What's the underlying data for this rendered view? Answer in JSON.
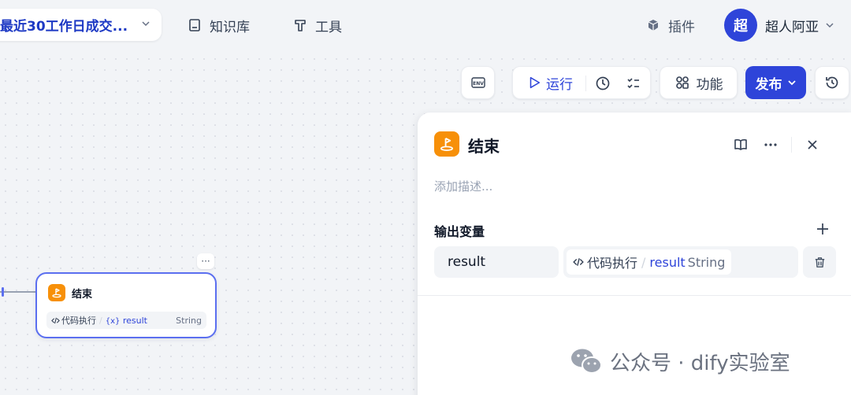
{
  "app": {
    "title": "最近30工作日成交..."
  },
  "nav": {
    "knowledge": "知识库",
    "tools": "工具",
    "plugins": "插件"
  },
  "user": {
    "avatar_text": "超",
    "name": "超人阿亚"
  },
  "toolbar": {
    "env": "ENV",
    "run": "运行",
    "features": "功能",
    "publish": "发布"
  },
  "node": {
    "title": "结束",
    "more": "···",
    "output": {
      "source": "代码执行",
      "variable": "result",
      "type": "String"
    }
  },
  "panel": {
    "title": "结束",
    "description_placeholder": "添加描述...",
    "section_title": "输出变量",
    "outputs": [
      {
        "name": "result",
        "source": "代码执行",
        "variable": "result",
        "type": "String"
      }
    ]
  },
  "watermark": {
    "text": "公众号 · dify实验室"
  },
  "colors": {
    "accent": "#2e44d9",
    "node_icon": "#f79009"
  }
}
